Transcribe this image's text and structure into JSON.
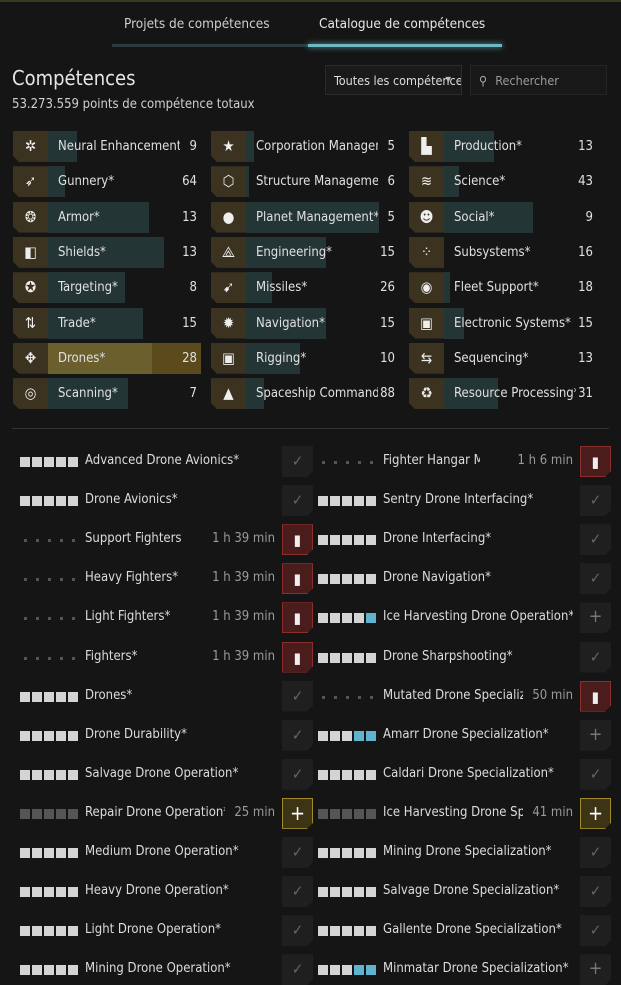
{
  "tabs": [
    {
      "label": "Projets de compétences",
      "active": false
    },
    {
      "label": "Catalogue de compétences",
      "active": true
    }
  ],
  "header": {
    "title": "Compétences",
    "total": "53.273.559 points de compétence totaux"
  },
  "filter": {
    "selected": "Toutes les compétences",
    "icon": "chevron-down-icon"
  },
  "search": {
    "placeholder": "Rechercher",
    "icon": "search-icon"
  },
  "colors": {
    "accent": "#6fb8c2",
    "selected": "#5a4a1c",
    "queued_level": "#5fb3cf",
    "inject": "#8a2e2e",
    "train": "#a08a2a"
  },
  "categories": [
    {
      "name": "Neural Enhancement*",
      "count": "9",
      "fill": 0.19,
      "icon": "neural-icon",
      "glyph": "✲"
    },
    {
      "name": "Gunnery*",
      "count": "64",
      "fill": 0.11,
      "icon": "bullet-icon",
      "glyph": "➶"
    },
    {
      "name": "Armor*",
      "count": "13",
      "fill": 0.66,
      "icon": "armor-icon",
      "glyph": "❂"
    },
    {
      "name": "Shields*",
      "count": "13",
      "fill": 0.76,
      "icon": "shield-icon",
      "glyph": "◧"
    },
    {
      "name": "Targeting*",
      "count": "8",
      "fill": 0.5,
      "icon": "targeting-icon",
      "glyph": "✪"
    },
    {
      "name": "Trade*",
      "count": "15",
      "fill": 0.62,
      "icon": "trade-icon",
      "glyph": "⇅"
    },
    {
      "name": "Drones*",
      "count": "28",
      "fill": 0.68,
      "icon": "drone-icon",
      "glyph": "✥",
      "selected": true
    },
    {
      "name": "Scanning*",
      "count": "7",
      "fill": 0.52,
      "icon": "scanning-icon",
      "glyph": "◎"
    },
    {
      "name": "Corporation Management*",
      "count": "5",
      "fill": 0.05,
      "icon": "corporation-icon",
      "glyph": "★"
    },
    {
      "name": "Structure Management*",
      "count": "6",
      "fill": 0.02,
      "icon": "structure-icon",
      "glyph": "⬡"
    },
    {
      "name": "Planet Management*",
      "count": "5",
      "fill": 0.87,
      "icon": "planet-icon",
      "glyph": "●"
    },
    {
      "name": "Engineering*",
      "count": "15",
      "fill": 0.52,
      "icon": "engineering-icon",
      "glyph": "⟁"
    },
    {
      "name": "Missiles*",
      "count": "26",
      "fill": 0.17,
      "icon": "missile-icon",
      "glyph": "➹"
    },
    {
      "name": "Navigation*",
      "count": "15",
      "fill": 0.52,
      "icon": "navigation-icon",
      "glyph": "✹"
    },
    {
      "name": "Rigging*",
      "count": "10",
      "fill": 0.35,
      "icon": "rigging-icon",
      "glyph": "▣"
    },
    {
      "name": "Spaceship Command*",
      "count": "88",
      "fill": 0.12,
      "icon": "spaceship-icon",
      "glyph": "▲"
    },
    {
      "name": "Production*",
      "count": "13",
      "fill": 0.33,
      "icon": "factory-icon",
      "glyph": "▙"
    },
    {
      "name": "Science*",
      "count": "43",
      "fill": 0.1,
      "icon": "dna-icon",
      "glyph": "≋"
    },
    {
      "name": "Social*",
      "count": "9",
      "fill": 0.58,
      "icon": "social-icon",
      "glyph": "☻"
    },
    {
      "name": "Subsystems*",
      "count": "16",
      "fill": 0.0,
      "icon": "subsystems-icon",
      "glyph": "⁘"
    },
    {
      "name": "Fleet Support*",
      "count": "18",
      "fill": 0.04,
      "icon": "fleet-icon",
      "glyph": "◉"
    },
    {
      "name": "Electronic Systems*",
      "count": "15",
      "fill": 0.13,
      "icon": "chip-icon",
      "glyph": "▣"
    },
    {
      "name": "Sequencing*",
      "count": "13",
      "fill": 0.0,
      "icon": "sequencing-icon",
      "glyph": "⇆"
    },
    {
      "name": "Resource Processing*",
      "count": "31",
      "fill": 0.35,
      "icon": "recycle-icon",
      "glyph": "♻"
    }
  ],
  "skills_left": [
    {
      "name": "Advanced Drone Avionics*",
      "levels": "11111",
      "time": "",
      "action": "check"
    },
    {
      "name": "Drone Avionics*",
      "levels": "11111",
      "time": "",
      "action": "check"
    },
    {
      "name": "Support Fighters*",
      "levels": "ddddd",
      "time": "1 h 39 min",
      "action": "inject"
    },
    {
      "name": "Heavy Fighters*",
      "levels": "ddddd",
      "time": "1 h 39 min",
      "action": "inject"
    },
    {
      "name": "Light Fighters*",
      "levels": "ddddd",
      "time": "1 h 39 min",
      "action": "inject"
    },
    {
      "name": "Fighters*",
      "levels": "ddddd",
      "time": "1 h 39 min",
      "action": "inject"
    },
    {
      "name": "Drones*",
      "levels": "11111",
      "time": "",
      "action": "check"
    },
    {
      "name": "Drone Durability*",
      "levels": "11111",
      "time": "",
      "action": "check"
    },
    {
      "name": "Salvage Drone Operation*",
      "levels": "11111",
      "time": "",
      "action": "check"
    },
    {
      "name": "Repair Drone Operation*",
      "levels": "ggggg",
      "time": "25 min",
      "action": "train"
    },
    {
      "name": "Medium Drone Operation*",
      "levels": "11111",
      "time": "",
      "action": "check"
    },
    {
      "name": "Heavy Drone Operation*",
      "levels": "11111",
      "time": "",
      "action": "check"
    },
    {
      "name": "Light Drone Operation*",
      "levels": "11111",
      "time": "",
      "action": "check"
    },
    {
      "name": "Mining Drone Operation*",
      "levels": "11111",
      "time": "",
      "action": "check"
    }
  ],
  "skills_right": [
    {
      "name": "Fighter Hangar Management*",
      "levels": "ddddd",
      "time": "1 h 6 min",
      "action": "inject"
    },
    {
      "name": "Sentry Drone Interfacing*",
      "levels": "11111",
      "time": "",
      "action": "check"
    },
    {
      "name": "Drone Interfacing*",
      "levels": "11111",
      "time": "",
      "action": "check"
    },
    {
      "name": "Drone Navigation*",
      "levels": "11111",
      "time": "",
      "action": "check"
    },
    {
      "name": "Ice Harvesting Drone Operation*",
      "levels": "1111q",
      "time": "",
      "action": "add"
    },
    {
      "name": "Drone Sharpshooting*",
      "levels": "11111",
      "time": "",
      "action": "check"
    },
    {
      "name": "Mutated Drone Specialization*",
      "levels": "ddddd",
      "time": "50 min",
      "action": "inject"
    },
    {
      "name": "Amarr Drone Specialization*",
      "levels": "111qq",
      "time": "",
      "action": "add"
    },
    {
      "name": "Caldari Drone Specialization*",
      "levels": "11111",
      "time": "",
      "action": "check"
    },
    {
      "name": "Ice Harvesting Drone Specialization*",
      "levels": "ggggg",
      "time": "41 min",
      "action": "train"
    },
    {
      "name": "Mining Drone Specialization*",
      "levels": "11111",
      "time": "",
      "action": "check"
    },
    {
      "name": "Salvage Drone Specialization*",
      "levels": "11111",
      "time": "",
      "action": "check"
    },
    {
      "name": "Gallente Drone Specialization*",
      "levels": "11111",
      "time": "",
      "action": "check"
    },
    {
      "name": "Minmatar Drone Specialization*",
      "levels": "111qq",
      "time": "",
      "action": "add"
    }
  ]
}
